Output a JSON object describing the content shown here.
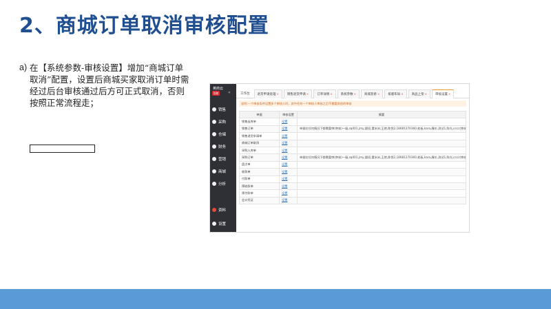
{
  "slide": {
    "title": "2、商城订单取消审核配置",
    "bullet_marker": "a)",
    "bullet_text": "在【系统参数-审核设置】增加“商城订单取消”配置，设置后商城买家取消订单时需经过后台审核通过后方可正式取消，否则按照正常流程走；"
  },
  "app": {
    "brand": "英商云",
    "brand_button": "导航",
    "sidebar": [
      {
        "label": "销售"
      },
      {
        "label": "采购"
      },
      {
        "label": "仓储"
      },
      {
        "label": "财务"
      },
      {
        "label": "营销"
      },
      {
        "label": "商城"
      },
      {
        "label": "分析"
      },
      {
        "label": "资料"
      },
      {
        "label": "设置"
      }
    ],
    "tabs": [
      {
        "label": "工作台"
      },
      {
        "label": "退货申请处理"
      },
      {
        "label": "销售退货申请"
      },
      {
        "label": "订单详情"
      },
      {
        "label": "系统参数"
      },
      {
        "label": "商城装修"
      },
      {
        "label": "排版布局"
      },
      {
        "label": "商品上架"
      },
      {
        "label": "审核设置"
      }
    ],
    "notice": "说明:一个审核条件设置多个审核人时，其中任何一个审核人审核之后不需要其他的审核",
    "table": {
      "headers": [
        "单据",
        "审核设置",
        "摘要"
      ],
      "rows": [
        {
          "doc": "销售出库单",
          "action": "设置",
          "summary": ""
        },
        {
          "doc": "销售订单",
          "action": "设置",
          "summary": "单据在任何情况下都需要审(审核)一级,zq001,jmy,跟班,董米米,王艳,陈悦2,18681270360,老板,kara,廉价,测试1,陈光,cccc(审核)"
        },
        {
          "doc": "销售退货申请单",
          "action": "设置",
          "summary": ""
        },
        {
          "doc": "商城订单取消",
          "action": "设置",
          "summary": ""
        },
        {
          "doc": "采购入库单",
          "action": "设置",
          "summary": ""
        },
        {
          "doc": "采购订单",
          "action": "设置",
          "summary": "单据在任何情况下都需要审(审核)一级,zq001,jmy,跟班,董米米,王艳,陈悦2,18681270360,老板,kara,廉价,测试1,陈光,cccc(审核)"
        },
        {
          "doc": "盘点单",
          "action": "设置",
          "summary": ""
        },
        {
          "doc": "收款单",
          "action": "设置",
          "summary": ""
        },
        {
          "doc": "付款单",
          "action": "设置",
          "summary": ""
        },
        {
          "doc": "预收款单",
          "action": "设置",
          "summary": ""
        },
        {
          "doc": "预付款单",
          "action": "设置",
          "summary": ""
        },
        {
          "doc": "会计凭证",
          "action": "设置",
          "summary": ""
        }
      ]
    }
  },
  "colors": {
    "title": "#1f4e91",
    "footer": "#5b9bd5",
    "sidebar": "#2f2f36",
    "accent": "#e04b3a"
  }
}
